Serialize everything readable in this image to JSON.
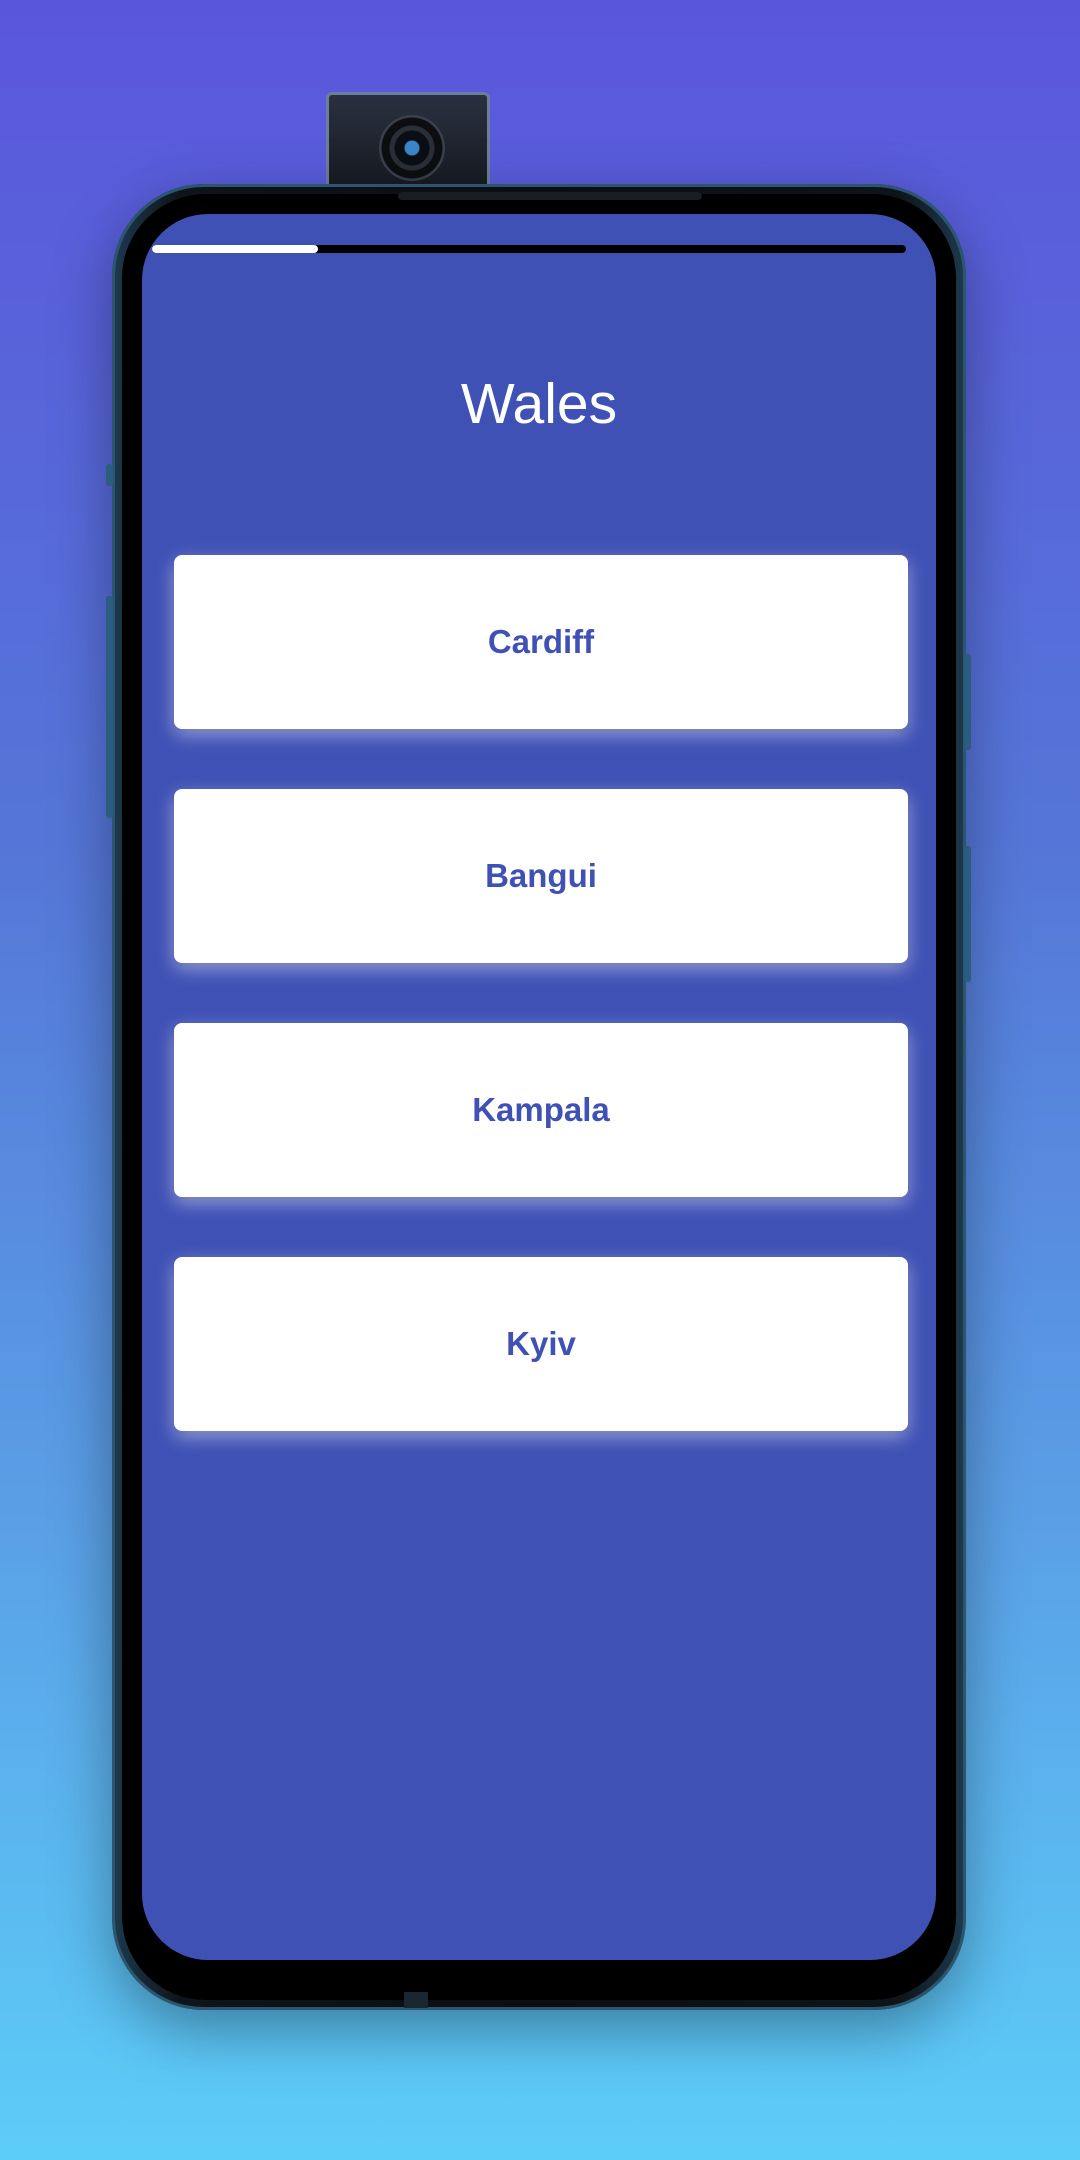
{
  "quiz": {
    "question": "Wales",
    "progress_fraction": 0.22,
    "answers": [
      "Cardiff",
      "Bangui",
      "Kampala",
      "Kyiv"
    ]
  },
  "colors": {
    "screen_background": "#3f51b5",
    "answer_text": "#3f51b5",
    "answer_background": "#ffffff",
    "progress_fill": "#ffffff",
    "progress_track": "#000000"
  }
}
